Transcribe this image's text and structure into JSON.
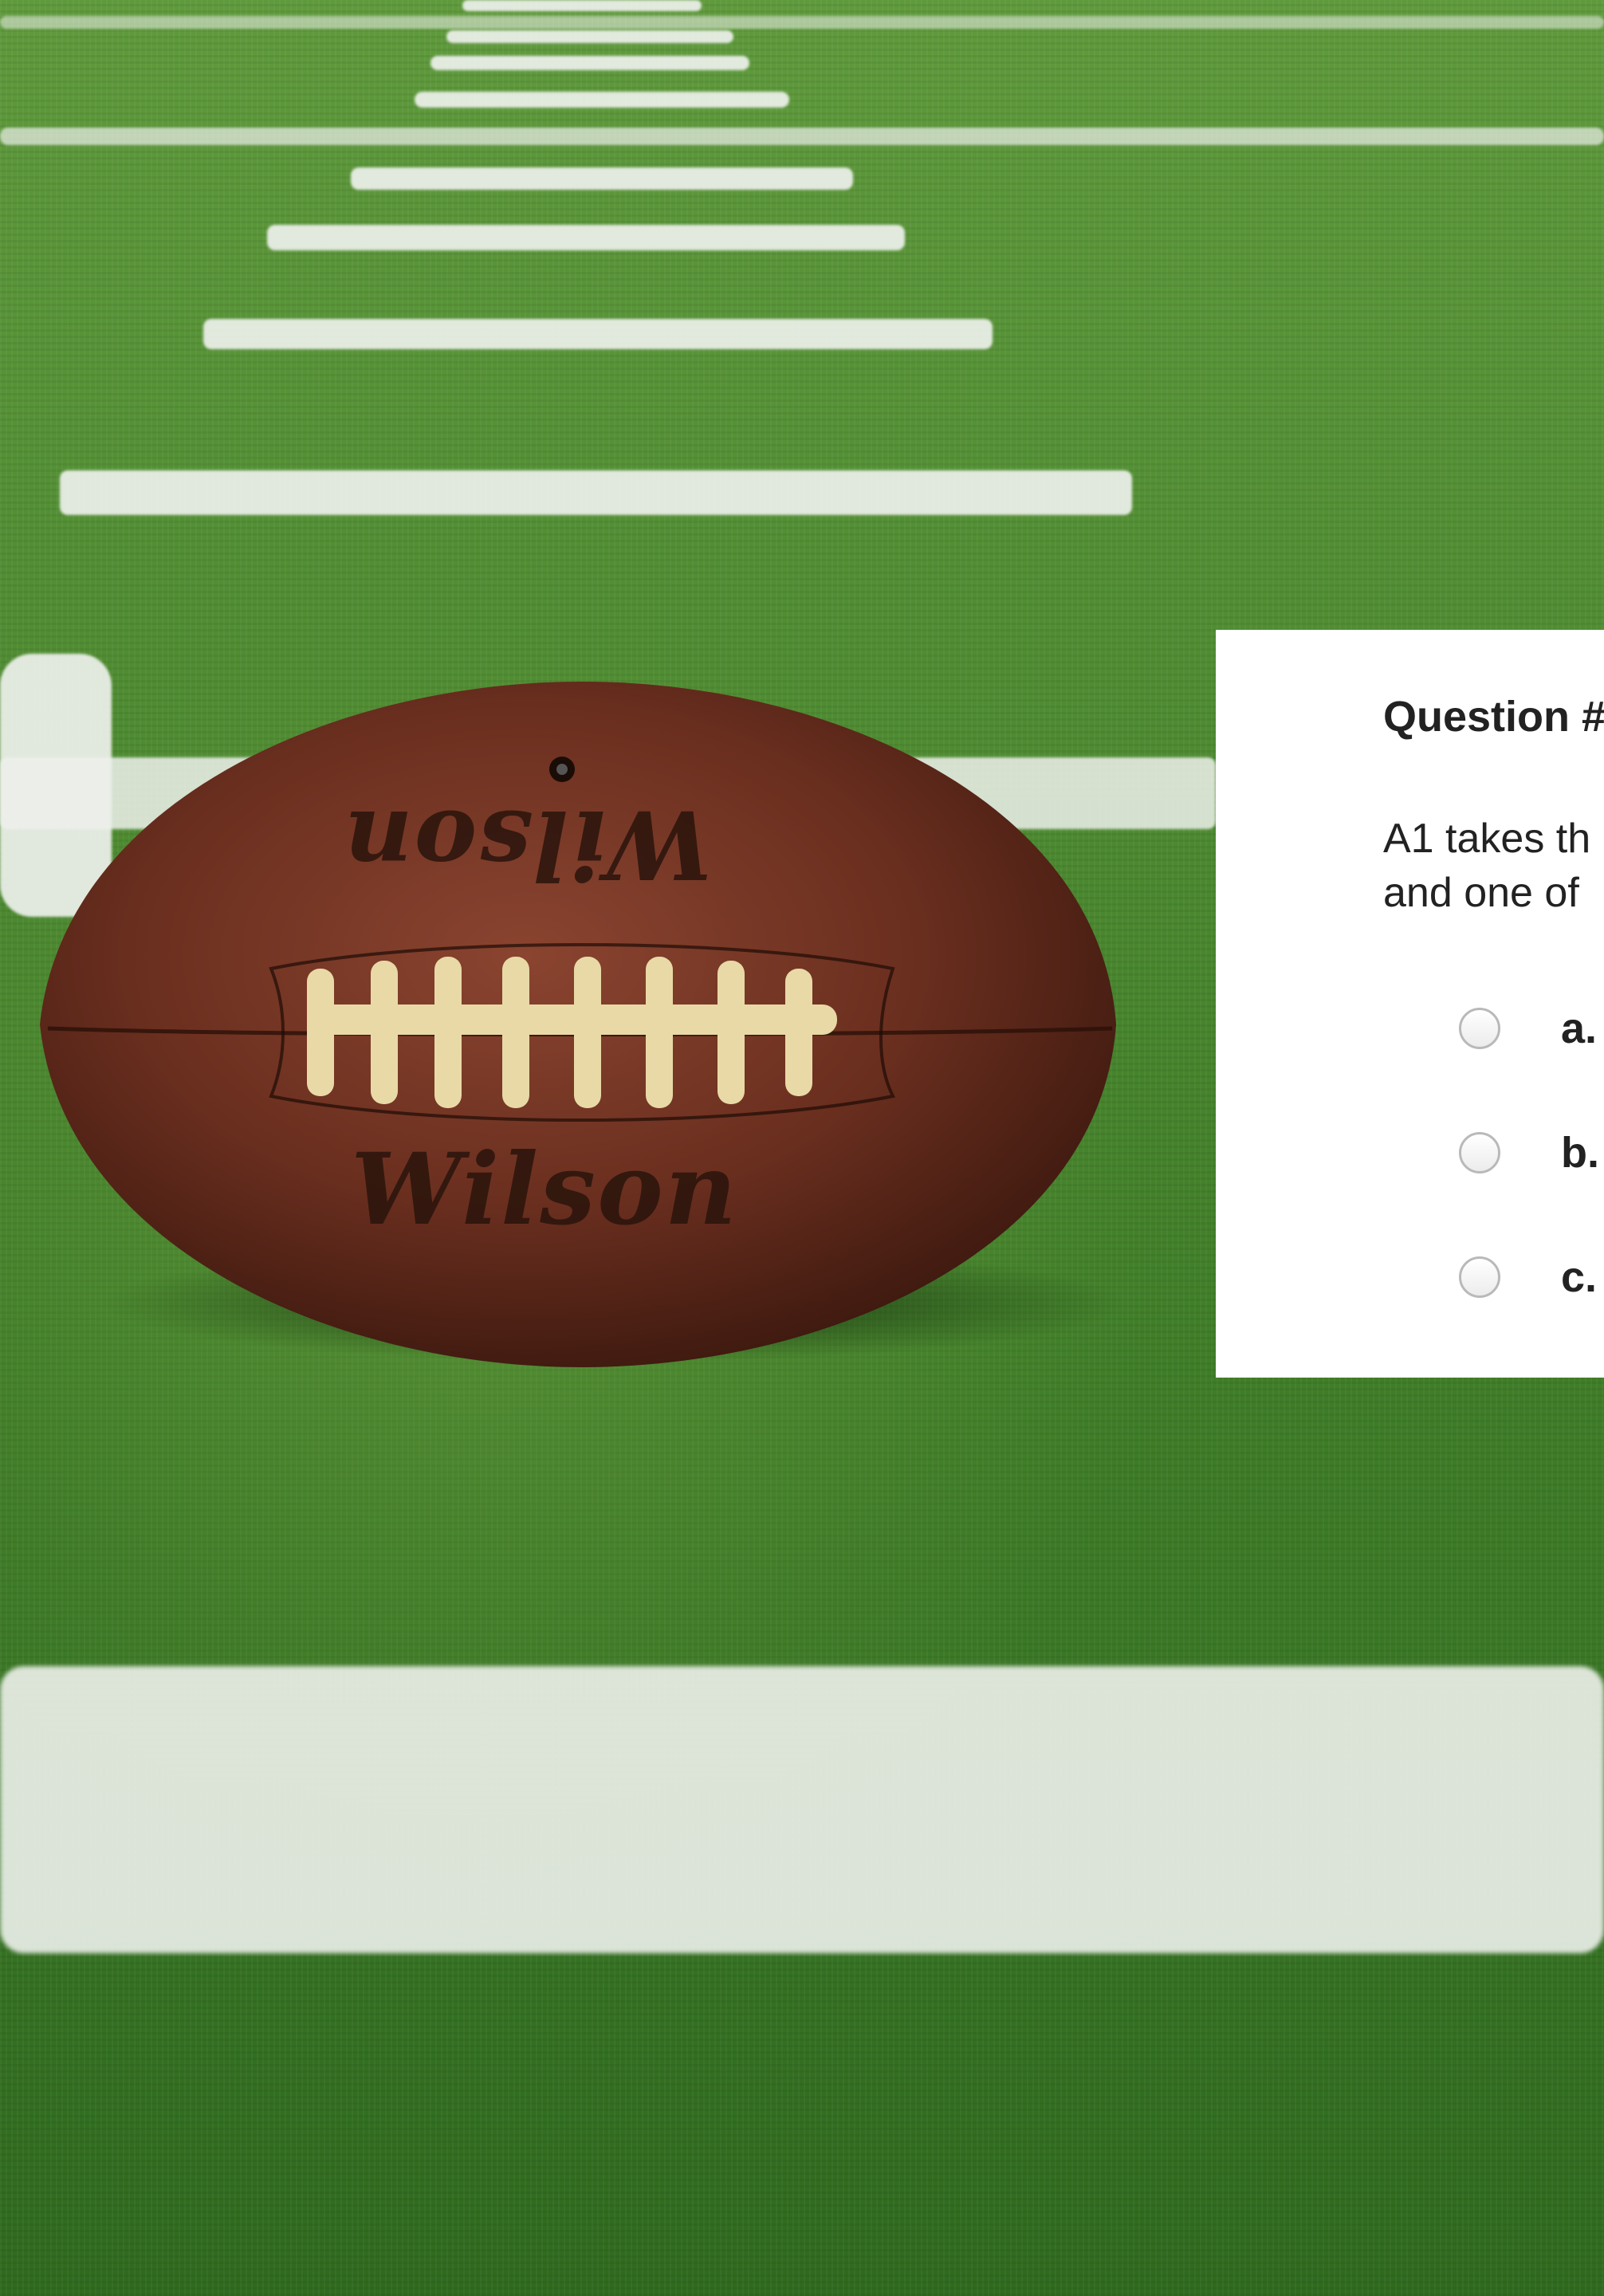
{
  "quiz": {
    "title": "Question #",
    "text_line1": "A1 takes th",
    "text_line2": "and one of",
    "options": [
      {
        "label": "a."
      },
      {
        "label": "b."
      },
      {
        "label": "c."
      }
    ]
  },
  "football": {
    "brand": "Wilson"
  },
  "colors": {
    "panel_bg": "#ffffff",
    "text": "#222222",
    "turf": "#4f8c32",
    "leather": "#6b2f1f",
    "laces": "#e8d9a6"
  }
}
